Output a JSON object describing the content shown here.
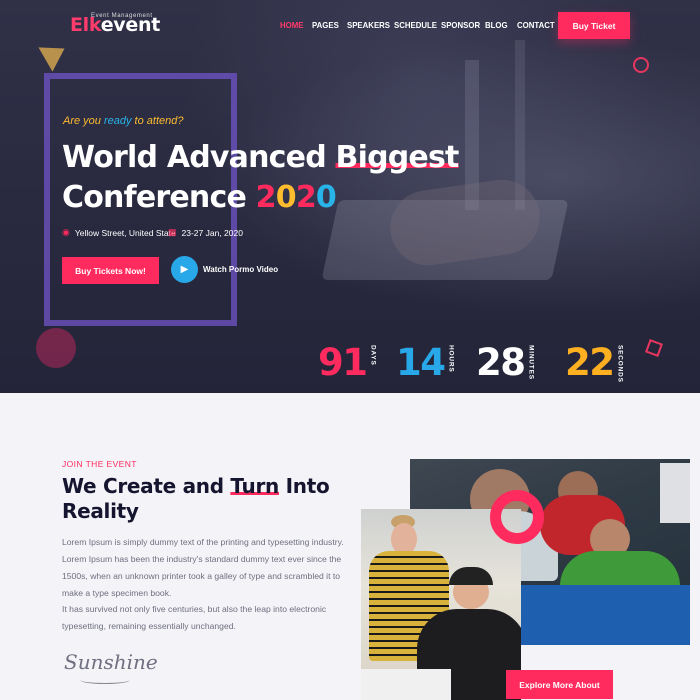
{
  "brand": {
    "name_accent": "Elk",
    "name_rest": "event",
    "subtitle": "Event Management"
  },
  "nav": {
    "items": [
      {
        "label": "Home",
        "active": true
      },
      {
        "label": "Pages",
        "active": false
      },
      {
        "label": "Speakers",
        "active": false
      },
      {
        "label": "Schedule",
        "active": false
      },
      {
        "label": "Sponsor",
        "active": false
      },
      {
        "label": "Blog",
        "active": false
      },
      {
        "label": "Contact",
        "active": false
      }
    ],
    "cta": "Buy Ticket"
  },
  "hero": {
    "tagline_pre": "Are you ",
    "tagline_hl": "ready",
    "tagline_post": " to attend?",
    "title_line1_a": "World Advanced ",
    "title_line1_b": "Biggest",
    "title_line2": "Conference ",
    "year_digits": [
      "2",
      "0",
      "2",
      "0"
    ],
    "location": "Yellow Street, United State",
    "date": "23-27 Jan, 2020",
    "buy_button": "Buy Tickets Now!",
    "video_label": "Watch Pormo Video"
  },
  "countdown": [
    {
      "value": "91",
      "unit": "Days",
      "color": "#ff2b5e"
    },
    {
      "value": "14",
      "unit": "Hours",
      "color": "#28a8e8"
    },
    {
      "value": "28",
      "unit": "Minutes",
      "color": "#ffffff"
    },
    {
      "value": "22",
      "unit": "Seconds",
      "color": "#ffb020"
    }
  ],
  "about": {
    "label": "JOIN THE EVENT",
    "title_a": "We Create and ",
    "title_hl": "Turn",
    "title_b": " Into Reality",
    "para1": "Lorem Ipsum is simply dummy text of the printing and typesetting industry. Lorem Ipsum has been the industry's standard dummy text ever since the 1500s, when an unknown printer took a galley of type and scrambled it to make a type specimen book.",
    "para2": "It has survived not only five centuries, but also the leap into electronic typesetting, remaining essentially unchanged.",
    "signature": "Sunshine",
    "explore_button": "Explore More About"
  },
  "colors": {
    "accent": "#ff2b5e",
    "blue": "#28a8e8",
    "yellow": "#ffbd2e",
    "dark": "#151530"
  }
}
